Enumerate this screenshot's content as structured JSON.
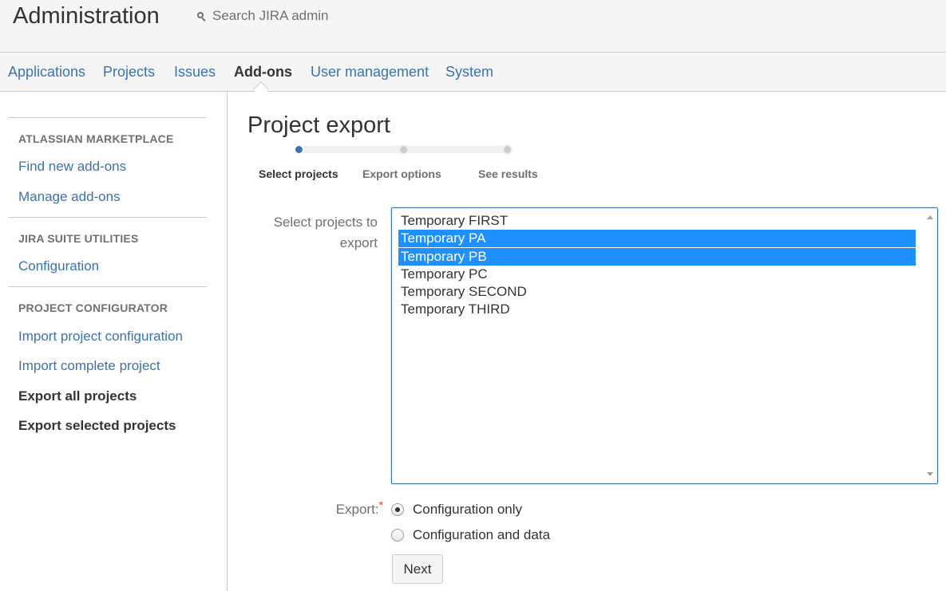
{
  "header": {
    "title": "Administration",
    "search_placeholder": "Search JIRA admin"
  },
  "nav": {
    "tabs": [
      {
        "label": "Applications"
      },
      {
        "label": "Projects"
      },
      {
        "label": "Issues"
      },
      {
        "label": "Add-ons"
      },
      {
        "label": "User management"
      },
      {
        "label": "System"
      }
    ],
    "active": "Add-ons"
  },
  "sidebar": {
    "sections": [
      {
        "heading": "ATLASSIAN MARKETPLACE",
        "items": [
          "Find new add-ons",
          "Manage add-ons"
        ]
      },
      {
        "heading": "JIRA SUITE UTILITIES",
        "items": [
          "Configuration"
        ]
      },
      {
        "heading": "PROJECT CONFIGURATOR",
        "items": [
          "Import project configuration",
          "Import complete project",
          "Export all projects",
          "Export selected projects"
        ]
      }
    ]
  },
  "main": {
    "title": "Project export",
    "steps": [
      {
        "label": "Select projects",
        "state": "current"
      },
      {
        "label": "Export options",
        "state": "pending"
      },
      {
        "label": "See results",
        "state": "pending"
      }
    ],
    "select_label_line1": "Select projects to",
    "select_label_line2": "export",
    "projects": [
      {
        "name": "Temporary FIRST",
        "selected": false
      },
      {
        "name": "Temporary PA",
        "selected": true
      },
      {
        "name": "Temporary PB",
        "selected": true
      },
      {
        "name": "Temporary PC",
        "selected": false
      },
      {
        "name": "Temporary SECOND",
        "selected": false
      },
      {
        "name": "Temporary THIRD",
        "selected": false
      }
    ],
    "export_label": "Export:",
    "required_mark": "*",
    "export_options": [
      {
        "label": "Configuration only",
        "checked": true
      },
      {
        "label": "Configuration and data",
        "checked": false
      }
    ],
    "next_label": "Next"
  },
  "colors": {
    "link": "#3b73af",
    "selection": "#1e90ff",
    "required": "#d04437"
  }
}
